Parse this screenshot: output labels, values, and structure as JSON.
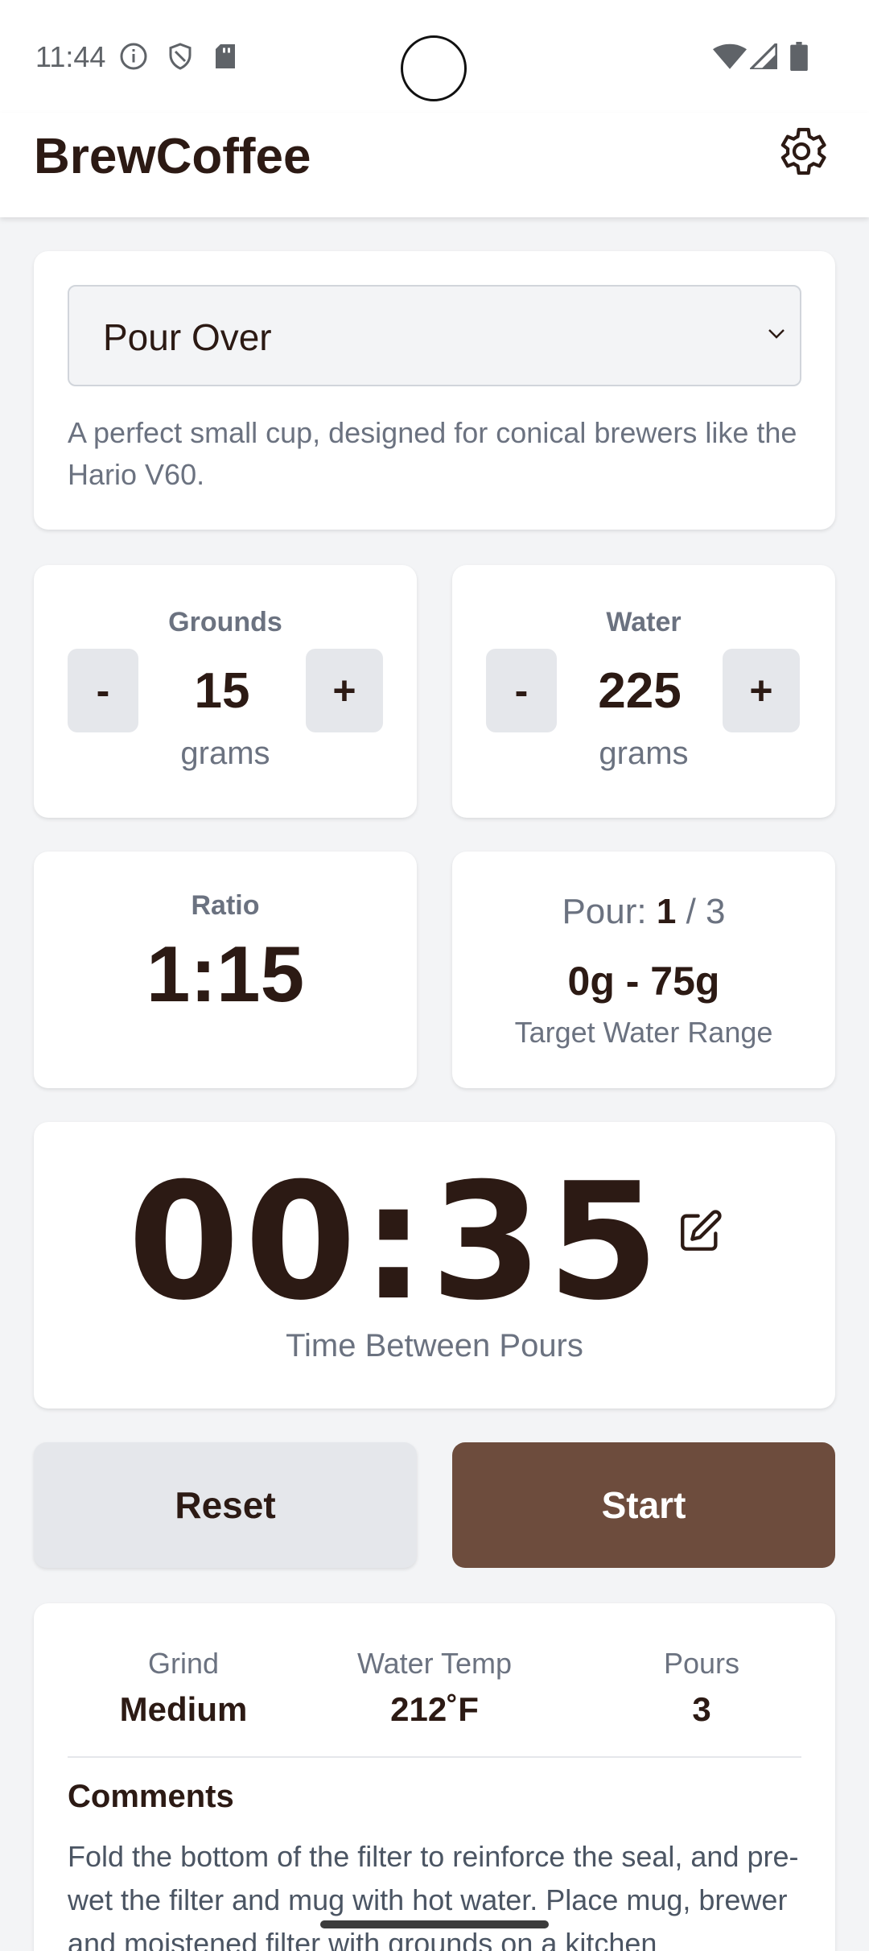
{
  "status": {
    "time": "11:44",
    "icons": [
      "info-icon",
      "shield-icon",
      "sd-card-icon",
      "wifi-icon",
      "signal-icon",
      "battery-icon"
    ]
  },
  "app": {
    "title": "BrewCoffee",
    "settings_icon": "gear-icon"
  },
  "method": {
    "selected": "Pour Over",
    "description": "A perfect small cup, designed for conical brewers like the Hario V60."
  },
  "grounds": {
    "label": "Grounds",
    "minus": "-",
    "plus": "+",
    "value": "15",
    "unit": "grams"
  },
  "water": {
    "label": "Water",
    "minus": "-",
    "plus": "+",
    "value": "225",
    "unit": "grams"
  },
  "ratio": {
    "label": "Ratio",
    "value": "1:15"
  },
  "pour": {
    "label": "Pour:",
    "current": "1",
    "separator": "/",
    "total": "3",
    "range": "0g - 75g",
    "range_label": "Target Water Range"
  },
  "timer": {
    "value": "00:35",
    "label": "Time Between Pours"
  },
  "actions": {
    "reset": "Reset",
    "start": "Start"
  },
  "info": {
    "grind_label": "Grind",
    "grind_value": "Medium",
    "temp_label": "Water Temp",
    "temp_value": "212˚F",
    "pours_label": "Pours",
    "pours_value": "3",
    "comments_title": "Comments",
    "comments_text": "Fold the bottom of the filter to reinforce the seal, and pre-wet the filter and mug with hot water. Place mug, brewer and moistened filter with grounds on a kitchen"
  },
  "colors": {
    "background": "#f3f4f6",
    "text_primary": "#2c1a14",
    "text_secondary": "#6b7280",
    "accent": "#6d4c3d",
    "button_neutral": "#e5e7eb"
  }
}
